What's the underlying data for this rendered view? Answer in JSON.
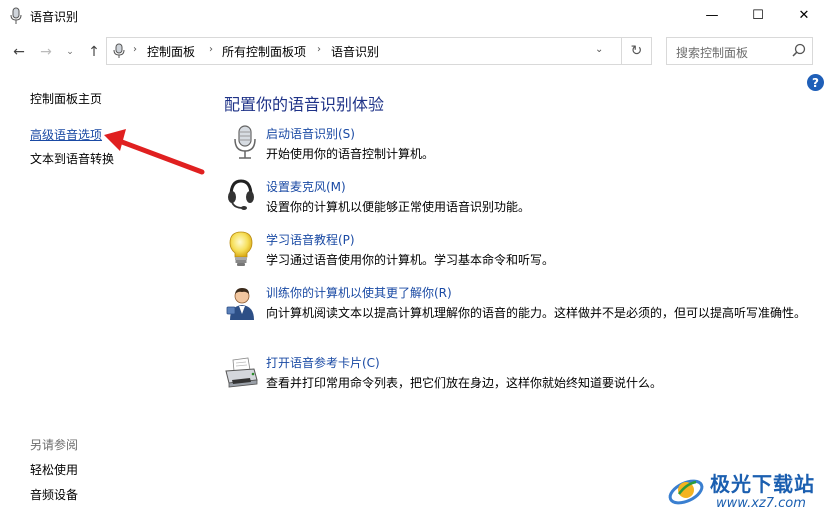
{
  "window": {
    "title": "语音识别",
    "minimize": "—",
    "maximize": "☐",
    "close": "✕"
  },
  "nav": {
    "back": "←",
    "forward": "→",
    "history": "⌄",
    "up": "↑"
  },
  "address": {
    "crumbs": [
      "控制面板",
      "所有控制面板项",
      "语音识别"
    ],
    "separator": "›",
    "dropdown": "⌄",
    "refresh": "↻"
  },
  "search": {
    "placeholder": "搜索控制面板"
  },
  "help": "?",
  "sidebar": {
    "items": [
      {
        "label": "控制面板主页"
      },
      {
        "label": "高级语音选项"
      },
      {
        "label": "文本到语音转换"
      }
    ],
    "see_also_title": "另请参阅",
    "see_also": [
      {
        "label": "轻松使用"
      },
      {
        "label": "音频设备"
      }
    ]
  },
  "main": {
    "title": "配置你的语音识别体验",
    "tasks": [
      {
        "icon": "microphone-icon",
        "link": "启动语音识别(S)",
        "desc": "开始使用你的语音控制计算机。"
      },
      {
        "icon": "headset-icon",
        "link": "设置麦克风(M)",
        "desc": "设置你的计算机以便能够正常使用语音识别功能。"
      },
      {
        "icon": "lightbulb-icon",
        "link": "学习语音教程(P)",
        "desc": "学习通过语音使用你的计算机。学习基本命令和听写。"
      },
      {
        "icon": "user-training-icon",
        "link": "训练你的计算机以使其更了解你(R)",
        "desc": "向计算机阅读文本以提高计算机理解你的语音的能力。这样做并不是必须的，但可以提高听写准确性。"
      },
      {
        "icon": "printer-icon",
        "link": "打开语音参考卡片(C)",
        "desc": "查看并打印常用命令列表，把它们放在身边，这样你就始终知道要说什么。"
      }
    ]
  },
  "watermark": {
    "name": "极光下载站",
    "url": "www.xz7.com"
  },
  "colors": {
    "link": "#1a4aa4",
    "title": "#1e3287",
    "arrow": "#e02020"
  }
}
